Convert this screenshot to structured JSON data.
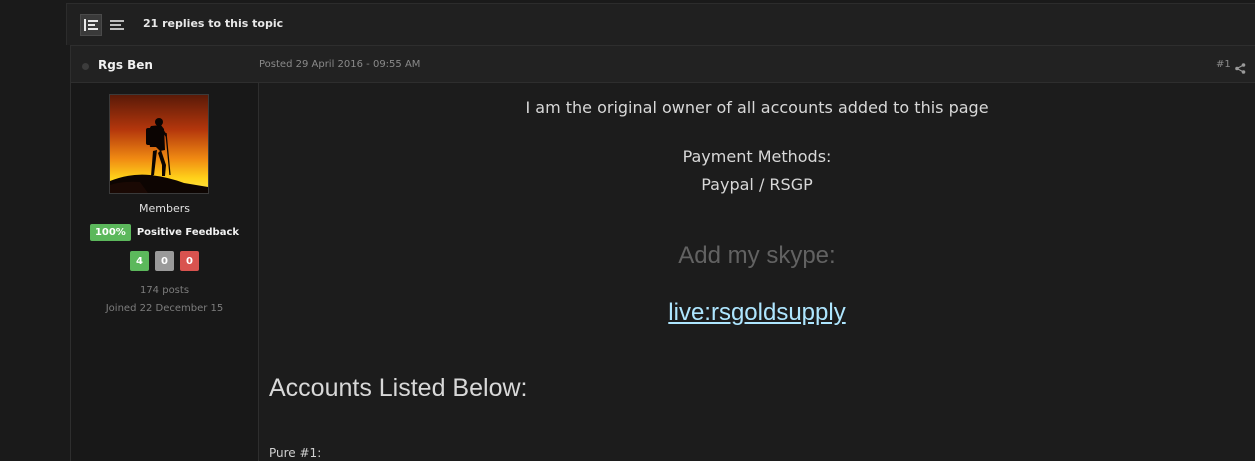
{
  "topic_bar": {
    "replies_text": "21 replies to this topic",
    "icons": [
      "list-view-icon",
      "linear-view-icon"
    ]
  },
  "post": {
    "author": "Rgs Ben",
    "posted": "Posted 29 April 2016 - 09:55 AM",
    "number": "#1",
    "icons": [
      "offline-status-icon",
      "share-icon"
    ]
  },
  "sidebar": {
    "avatar_icon": "hiker-silhouette-sunset-avatar",
    "group": "Members",
    "feedback_percent": "100%",
    "feedback_label": "Positive Feedback",
    "feedback_counts": {
      "positive": "4",
      "neutral": "0",
      "negative": "0"
    },
    "posts": "174 posts",
    "joined": "Joined 22 December 15"
  },
  "body": {
    "owner_line": "I am the original owner of all accounts added to this page",
    "payment_title": "Payment Methods:",
    "payment_methods": "Paypal / RSGP",
    "skype_label": "Add my skype:",
    "skype_link": "live:rsgoldsupply",
    "accounts_heading": "Accounts Listed Below:",
    "pure_label": "Pure #1:"
  },
  "colors": {
    "positive": "#5cb85c",
    "neutral": "#9a9a9a",
    "negative": "#d9534f",
    "link": "#aee6ff"
  }
}
